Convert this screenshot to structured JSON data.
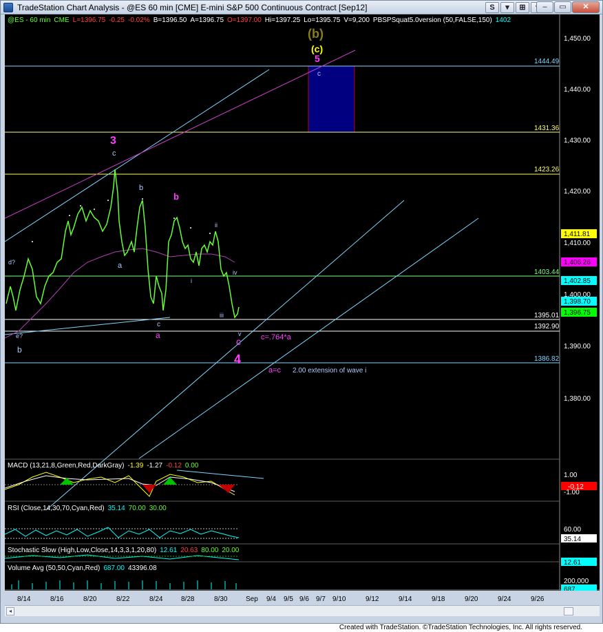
{
  "window": {
    "title": "TradeStation Chart Analysis - @ES 60 min [CME] E-mini S&P 500 Continuous Contract [Sep12]",
    "toolbar_buttons": [
      "S",
      "▾",
      "⊞",
      "▾"
    ],
    "window_controls": [
      "–",
      "▭",
      "✕"
    ]
  },
  "header": {
    "symbol": "@ES - 60 min",
    "exchange": "CME",
    "last": "L=1396.75",
    "change": "-0.25",
    "change_pct": "-0.02%",
    "bid": "B=1396.50",
    "ask": "A=1396.75",
    "open": "O=1397.00",
    "high": "Hi=1397.25",
    "low": "Lo=1395.75",
    "volume": "V=9,200",
    "study": "PBSPSquat5.0version (50,FALSE,150)",
    "value": "1402"
  },
  "price_axis": {
    "ticks": [
      "1,450.00",
      "1,440.00",
      "1,430.00",
      "1,420.00",
      "1,410.00",
      "1,400.00",
      "1,390.00",
      "1,380.00"
    ],
    "markers": [
      {
        "label": "1,411.81",
        "color": "#ffff00"
      },
      {
        "label": "1,406.26",
        "color": "#ff00ff"
      },
      {
        "label": "1,402.85",
        "color": "#00ffff"
      },
      {
        "label": "1,398.70",
        "color": "#00ffff"
      },
      {
        "label": "1,396.75",
        "color": "#00ff00"
      }
    ]
  },
  "levels": [
    {
      "label": "1444.49",
      "color": "#7fd6ff"
    },
    {
      "label": "1431.36",
      "color": "#ffff66"
    },
    {
      "label": "1423.26",
      "color": "#ffff66"
    },
    {
      "label": "1403.44",
      "color": "#7cff7c"
    },
    {
      "label": "1395.01",
      "color": "#ffffff"
    },
    {
      "label": "1392.90",
      "color": "#ffffff"
    },
    {
      "label": "1386.82",
      "color": "#7fd6ff"
    }
  ],
  "annotations": {
    "wave_b_big": "(b)",
    "wave_c_big": "(c)",
    "wave_5": "5",
    "wave_c_target": "c",
    "wave_3": "3",
    "wave_3_c": "c",
    "wave_b_1": "b",
    "wave_b_2": "b",
    "wave_a_1": "a",
    "wave_a_2": "a",
    "wave_c_small": "c",
    "wave_ii": "ii",
    "wave_i": "i",
    "wave_iii": "iii",
    "wave_iv": "iv",
    "wave_v": "v",
    "wave_c_4": "c",
    "wave_4": "4",
    "wave_d": "d?",
    "wave_e": "e?",
    "wave_b_low": "b",
    "ratio_label": "c=.764*a",
    "aec_label": "a=c",
    "extension_label": "2.00 extension of wave i"
  },
  "indicators": {
    "macd": {
      "name": "MACD (13,21,8,Green,Red,DarkGray)",
      "v1": "-1.39",
      "v2": "-1.27",
      "v3": "-0.12",
      "v4": "0.00",
      "ticks": [
        "1.00",
        "-1.00"
      ],
      "marker": "-0.12"
    },
    "rsi": {
      "name": "RSI (Close,14,30,70,Cyan,Red)",
      "v1": "35.14",
      "v2": "70.00",
      "v3": "30.00",
      "ticks": [
        "60.00"
      ],
      "marker": "35.14"
    },
    "stoch": {
      "name": "Stochastic Slow (High,Low,Close,14,3,3,1,20,80)",
      "v1": "12.61",
      "v2": "20.63",
      "v3": "80.00",
      "v4": "20.00",
      "marker": "12.61"
    },
    "volume": {
      "name": "Volume Avg (50,50,Cyan,Red)",
      "v1": "687.00",
      "v2": "43396.08",
      "ticks": [
        "200,000"
      ],
      "marker": "687"
    }
  },
  "time_axis": [
    "8/14",
    "8/16",
    "8/20",
    "8/22",
    "8/24",
    "8/28",
    "8/30",
    "Sep",
    "9/4",
    "9/5",
    "9/6",
    "9/7",
    "9/10",
    "9/12",
    "9/14",
    "9/18",
    "9/20",
    "9/24",
    "9/26"
  ],
  "footer": "Created with TradeStation. ©TradeStation Technologies, Inc. All rights reserved."
}
